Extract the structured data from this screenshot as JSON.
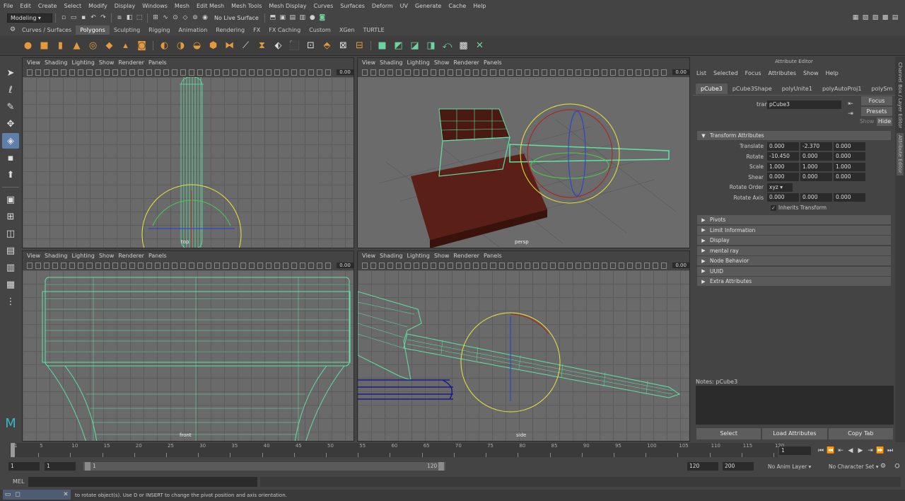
{
  "menubar": [
    "File",
    "Edit",
    "Create",
    "Select",
    "Modify",
    "Display",
    "Windows",
    "Mesh",
    "Edit Mesh",
    "Mesh Tools",
    "Mesh Display",
    "Curves",
    "Surfaces",
    "Deform",
    "UV",
    "Generate",
    "Cache",
    "Help"
  ],
  "status": {
    "mode": "Modeling",
    "live_surface": "No Live Surface"
  },
  "shelf_tabs": [
    "Curves / Surfaces",
    "Polygons",
    "Sculpting",
    "Rigging",
    "Animation",
    "Rendering",
    "FX",
    "FX Caching",
    "Custom",
    "XGen",
    "TURTLE"
  ],
  "shelf_active": "Polygons",
  "viewport_menu": [
    "View",
    "Shading",
    "Lighting",
    "Show",
    "Renderer",
    "Panels"
  ],
  "viewports": {
    "top": {
      "label": "top",
      "zoom": "0.00"
    },
    "persp": {
      "label": "persp",
      "zoom": "0.00"
    },
    "front": {
      "label": "front",
      "zoom": "0.00"
    },
    "side": {
      "label": "side",
      "zoom": "0.00"
    }
  },
  "attribute_editor": {
    "title": "Attribute Editor",
    "menu": [
      "List",
      "Selected",
      "Focus",
      "Attributes",
      "Show",
      "Help"
    ],
    "tabs": [
      "pCube3",
      "pCube3Shape",
      "polyUnite1",
      "polyAutoProj1",
      "polySm"
    ],
    "transform_label": "transform:",
    "transform_value": "pCube3",
    "focus_btn": "Focus",
    "presets_btn": "Presets",
    "show_label": "Show",
    "hide_btn": "Hide",
    "section_transform": "Transform Attributes",
    "translate": {
      "label": "Translate",
      "values": [
        "0.000",
        "-2.370",
        "0.000"
      ]
    },
    "rotate": {
      "label": "Rotate",
      "values": [
        "-10.450",
        "0.000",
        "0.000"
      ]
    },
    "scale": {
      "label": "Scale",
      "values": [
        "1.000",
        "1.000",
        "1.000"
      ]
    },
    "shear": {
      "label": "Shear",
      "values": [
        "0.000",
        "0.000",
        "0.000"
      ]
    },
    "rotate_order": {
      "label": "Rotate Order",
      "value": "xyz"
    },
    "rotate_axis": {
      "label": "Rotate Axis",
      "values": [
        "0.000",
        "0.000",
        "0.000"
      ]
    },
    "inherits": "Inherits Transform",
    "sections": [
      "Pivots",
      "Limit Information",
      "Display",
      "mental ray",
      "Node Behavior",
      "UUID",
      "Extra Attributes"
    ],
    "notes_label": "Notes:  pCube3",
    "buttons": [
      "Select",
      "Load Attributes",
      "Copy Tab"
    ]
  },
  "side_tabs": [
    "Channel Box / Layer Editor",
    "Attribute Editor"
  ],
  "timeline": {
    "ticks": [
      "1",
      "5",
      "10",
      "15",
      "20",
      "25",
      "30",
      "35",
      "40",
      "45",
      "50",
      "55",
      "60",
      "65",
      "70",
      "75",
      "80",
      "85",
      "90",
      "95",
      "100",
      "105",
      "110",
      "115",
      "120"
    ],
    "current": "1"
  },
  "range": {
    "start": "1",
    "inner_start": "1",
    "slider_start": "1",
    "slider_end": "120",
    "end": "120",
    "outer_end": "200",
    "anim_layer": "No Anim Layer",
    "char_set": "No Character Set"
  },
  "command": {
    "lang": "MEL"
  },
  "help_line": "to rotate object(s). Use D or INSERT to change the pivot position and axis orientation."
}
